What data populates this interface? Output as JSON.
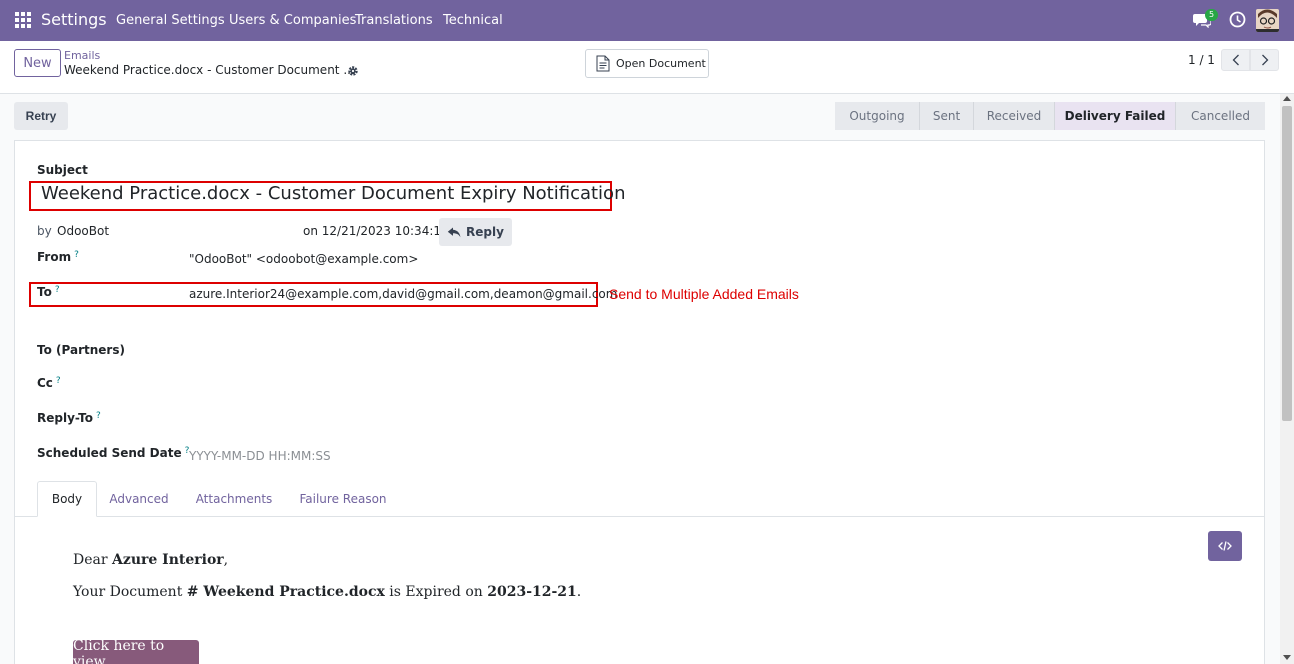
{
  "navbar": {
    "app_name": "Settings",
    "menu": [
      "General Settings",
      "Users & Companies",
      "Translations",
      "Technical"
    ],
    "chat_badge": "5"
  },
  "control": {
    "new_label": "New",
    "breadcrumb_parent": "Emails",
    "breadcrumb_current": "Weekend Practice.docx - Customer Document ...",
    "open_document_label": "Open Document",
    "pager": "1 / 1"
  },
  "actions": {
    "retry_label": "Retry"
  },
  "statusbar": {
    "stages": [
      "Outgoing",
      "Sent",
      "Received",
      "Delivery Failed",
      "Cancelled"
    ],
    "active": "Delivery Failed"
  },
  "form": {
    "subject_label": "Subject",
    "subject_value": "Weekend Practice.docx - Customer Document Expiry Notification",
    "by_label": "by",
    "author": "OdooBot",
    "date_text": "on 12/21/2023 10:34:19",
    "reply_label": "Reply",
    "from_label": "From",
    "from_value": "\"OdooBot\" <odoobot@example.com>",
    "to_label": "To",
    "to_value": "azure.Interior24@example.com,david@gmail.com,deamon@gmail.com",
    "annotation": "Send to Multiple Added Emails",
    "to_partners_label": "To (Partners)",
    "cc_label": "Cc",
    "reply_to_label": "Reply-To",
    "scheduled_label": "Scheduled Send Date",
    "scheduled_placeholder": "YYYY-MM-DD HH:MM:SS",
    "help_mark": "?"
  },
  "tabs": [
    "Body",
    "Advanced",
    "Attachments",
    "Failure Reason"
  ],
  "body": {
    "greeting_prefix": "Dear ",
    "customer": "Azure Interior",
    "greeting_suffix": ",",
    "line_prefix": "Your Document ",
    "doc_name": "# Weekend Practice.docx",
    "line_middle": " is Expired on ",
    "expiry_date": "2023-12-21",
    "line_suffix": ".",
    "view_button": "Click here to view"
  },
  "colors": {
    "navbar": "#71639e",
    "annotation": "#dd0000",
    "view_button": "#875a7b"
  }
}
